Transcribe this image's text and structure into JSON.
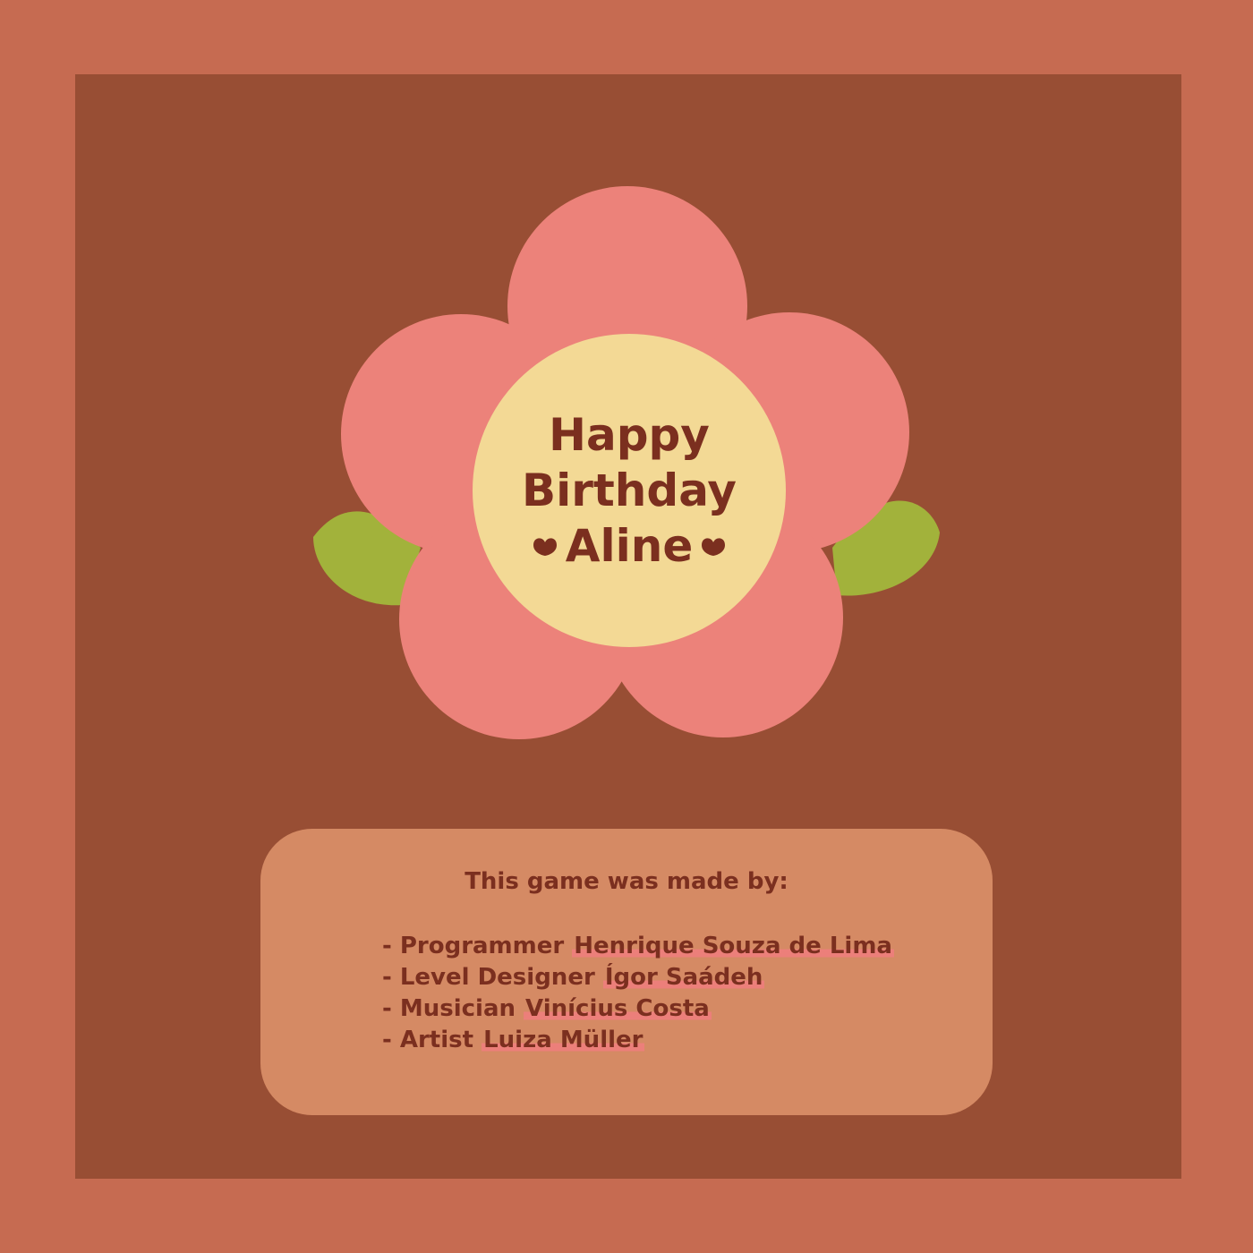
{
  "greeting": {
    "line1": "Happy",
    "line2": "Birthday",
    "name": "Aline"
  },
  "icons": {
    "left_decoration": "heart-icon",
    "right_decoration": "heart-icon"
  },
  "credits": {
    "title": "This game was made by:",
    "members": [
      {
        "role": "- Programmer ",
        "name": "Henrique Souza de Lima"
      },
      {
        "role": "- Level Designer ",
        "name": "Ígor Saádeh"
      },
      {
        "role": "- Musician ",
        "name": "Vinícius Costa"
      },
      {
        "role": "- Artist ",
        "name": "Luiza Müller"
      }
    ]
  },
  "colors": {
    "outer_frame": "#c66b51",
    "panel": "#984e34",
    "petal": "#ec827a",
    "center": "#f3d995",
    "leaf": "#a2b23b",
    "credits_box": "#d58a64",
    "text": "#7b2f1f",
    "highlight": "#ec7f7a"
  }
}
